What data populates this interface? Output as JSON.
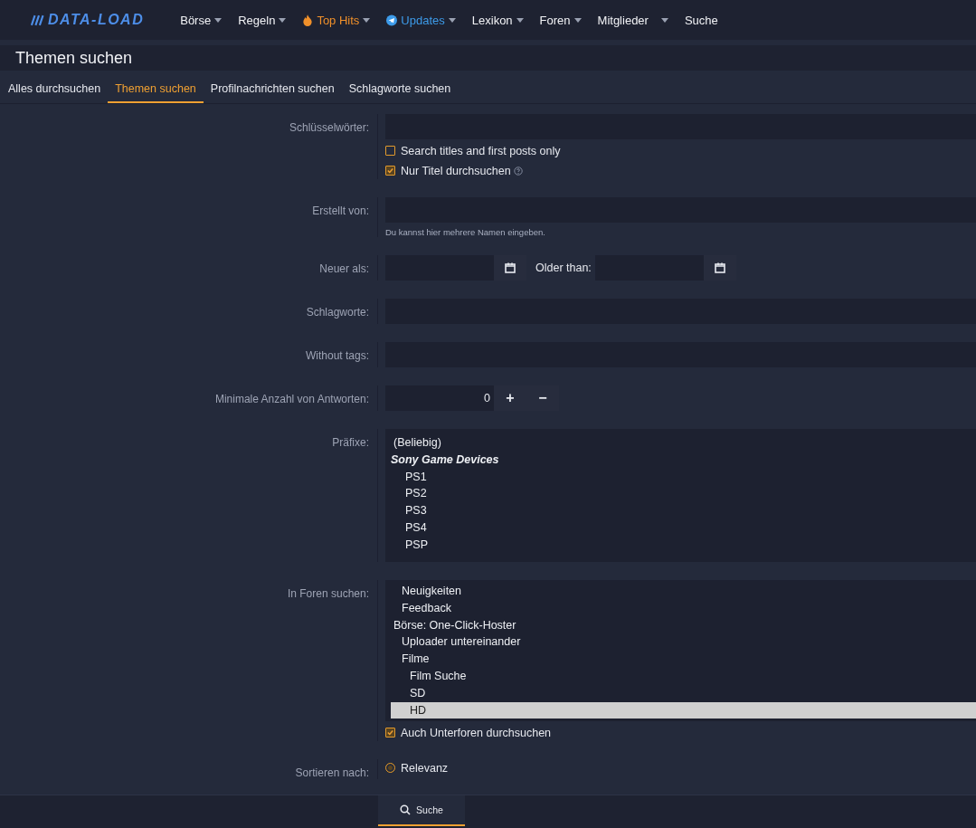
{
  "nav": {
    "logo": "DATA-LOAD",
    "items": [
      {
        "label": "Börse",
        "kind": "plain",
        "has_menu": true
      },
      {
        "label": "Regeln",
        "kind": "plain",
        "has_menu": true
      },
      {
        "label": "Top Hits",
        "kind": "hot",
        "has_menu": true
      },
      {
        "label": "Updates",
        "kind": "updates",
        "has_menu": true
      },
      {
        "label": "Lexikon",
        "kind": "plain",
        "has_menu": true
      },
      {
        "label": "Foren",
        "kind": "plain",
        "has_menu": true
      },
      {
        "label": "Mitglieder",
        "kind": "split",
        "has_menu": true
      },
      {
        "label": "Suche",
        "kind": "plain",
        "has_menu": false
      }
    ]
  },
  "page_title": "Themen suchen",
  "tabs": [
    {
      "label": "Alles durchsuchen",
      "selected": false
    },
    {
      "label": "Themen suchen",
      "selected": true
    },
    {
      "label": "Profilnachrichten suchen",
      "selected": false
    },
    {
      "label": "Schlagworte suchen",
      "selected": false
    }
  ],
  "form": [
    {
      "kind": "text",
      "label": "Schlüsselwörter:",
      "checkboxes": [
        {
          "label": "Search titles and first posts only",
          "checked": false,
          "help": false
        },
        {
          "label": "Nur Titel durchsuchen",
          "checked": true,
          "help": true
        }
      ]
    },
    {
      "kind": "text",
      "label": "Erstellt von:",
      "hint": "Du kannst hier mehrere Namen eingeben."
    },
    {
      "kind": "date-range",
      "label": "Neuer als:",
      "second_label": "Older than:"
    },
    {
      "kind": "text",
      "label": "Schlagworte:"
    },
    {
      "kind": "text",
      "label": "Without tags:"
    },
    {
      "kind": "number",
      "label": "Minimale Anzahl von Antworten:",
      "value": "0",
      "plus": "+",
      "minus": "−"
    },
    {
      "kind": "listbox",
      "label": "Präfixe:",
      "items": [
        {
          "label": "(Beliebig)",
          "kind": "option",
          "selected": false
        },
        {
          "label": "Sony Game Devices",
          "kind": "group",
          "children": [
            {
              "label": "PS1",
              "kind": "option",
              "selected": false
            },
            {
              "label": "PS2",
              "kind": "option",
              "selected": false
            },
            {
              "label": "PS3",
              "kind": "option",
              "selected": false
            },
            {
              "label": "PS4",
              "kind": "option",
              "selected": false
            },
            {
              "label": "PSP",
              "kind": "option",
              "selected": false
            }
          ]
        }
      ]
    },
    {
      "kind": "listbox",
      "label": "In Foren suchen:",
      "checkboxes": [
        {
          "label": "Auch Unterforen durchsuchen",
          "checked": true,
          "help": false
        }
      ],
      "items": [
        {
          "kind": "hidden",
          "children": [
            {
              "label": "Neuigkeiten",
              "kind": "option",
              "selected": false
            },
            {
              "label": "Feedback",
              "kind": "option",
              "selected": false
            }
          ]
        },
        {
          "label": "Börse: One-Click-Hoster",
          "kind": "option",
          "selected": false,
          "children": [
            {
              "label": "Uploader untereinander",
              "kind": "option",
              "selected": false
            },
            {
              "label": "Filme",
              "kind": "option",
              "selected": false,
              "children": [
                {
                  "label": "Film Suche",
                  "kind": "option",
                  "selected": false
                },
                {
                  "label": "SD",
                  "kind": "option",
                  "selected": false
                },
                {
                  "label": "HD",
                  "kind": "option",
                  "selected": true
                }
              ]
            }
          ]
        }
      ]
    },
    {
      "kind": "radio",
      "label": "Sortieren nach:",
      "options": [
        {
          "label": "Relevanz",
          "selected": true
        }
      ]
    }
  ],
  "submit": "Suche"
}
